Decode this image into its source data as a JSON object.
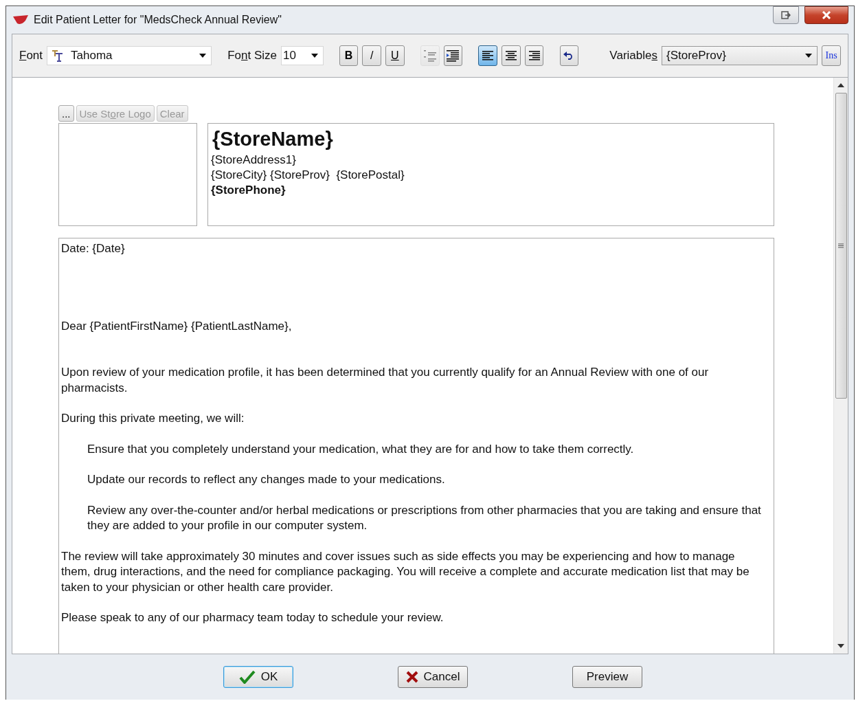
{
  "window": {
    "title": "Edit Patient Letter for \"MedsCheck Annual Review\""
  },
  "toolbar": {
    "font": {
      "label": [
        {
          "text": "F",
          "underlined": true
        },
        {
          "text": "ont"
        }
      ],
      "value": "Tahoma"
    },
    "font_size": {
      "label": [
        {
          "text": "Fo"
        },
        {
          "text": "n",
          "underlined": true
        },
        {
          "text": "t Size"
        }
      ],
      "value": "10"
    },
    "format_buttons": [
      {
        "kind": "bold",
        "text": "B",
        "selected": false,
        "disabled": false
      },
      {
        "kind": "italic",
        "text": "/",
        "selected": false,
        "disabled": false
      },
      {
        "kind": "underline",
        "text": "U",
        "selected": false,
        "disabled": false
      },
      {
        "kind": "bullets",
        "selected": false,
        "disabled": true
      },
      {
        "kind": "indent",
        "selected": false,
        "disabled": false
      },
      {
        "kind": "align-left",
        "selected": true,
        "disabled": false
      },
      {
        "kind": "align-center",
        "selected": false,
        "disabled": false
      },
      {
        "kind": "align-right",
        "selected": false,
        "disabled": false
      },
      {
        "kind": "undo",
        "selected": false,
        "disabled": false
      }
    ],
    "variables": {
      "label": [
        {
          "text": "Variable"
        },
        {
          "text": "s",
          "underlined": true
        }
      ],
      "value": "{StoreProv}"
    },
    "insert_button": "Ins"
  },
  "letter": {
    "logo_buttons": [
      {
        "label": [
          {
            "text": "..."
          }
        ],
        "disabled": false
      },
      {
        "label": [
          {
            "text": "Use St"
          },
          {
            "text": "o",
            "underlined": true
          },
          {
            "text": "re Logo"
          }
        ],
        "disabled": true
      },
      {
        "label": [
          {
            "text": "Clear"
          }
        ],
        "disabled": true
      }
    ],
    "header_lines": [
      {
        "kind": "title",
        "text": "{StoreName}"
      },
      {
        "kind": "normal",
        "text": "{StoreAddress1}"
      },
      {
        "kind": "normal",
        "text": "{StoreCity} {StoreProv}  {StorePostal}"
      },
      {
        "kind": "bold",
        "text": "{StorePhone}"
      }
    ],
    "body": [
      {
        "kind": "date",
        "text": "Date: {Date}"
      },
      {
        "kind": "salutation",
        "text": "Dear {PatientFirstName} {PatientLastName},"
      },
      {
        "kind": "opening",
        "text": "Upon review of your medication profile, it has been determined that you currently qualify for an Annual Review with one of our pharmacists."
      },
      {
        "kind": "paragraph",
        "text": "During this private meeting, we will:"
      },
      {
        "kind": "indented",
        "text": "Ensure that you completely understand your medication, what they are for and how to take them correctly."
      },
      {
        "kind": "indented",
        "text": "Update our records to reflect any changes made to your medications."
      },
      {
        "kind": "indented",
        "text": "Review any over-the-counter and/or herbal medications or prescriptions from other pharmacies that you are taking and ensure that they are added to your profile in our computer system."
      },
      {
        "kind": "paragraph",
        "text": "The review will take approximately 30 minutes and cover issues such as side effects you may be experiencing and how to manage them, drug interactions, and the need for compliance packaging.  You will receive a complete and accurate medication list that may be taken to your physician or other health care provider."
      },
      {
        "kind": "paragraph",
        "text": "Please speak to any of our pharmacy team today to schedule your review."
      }
    ]
  },
  "footer_buttons": [
    {
      "kind": "ok",
      "label": "OK",
      "default": true
    },
    {
      "kind": "cancel",
      "label": "Cancel",
      "default": false
    },
    {
      "kind": "plain",
      "label": "Preview",
      "default": false
    }
  ]
}
